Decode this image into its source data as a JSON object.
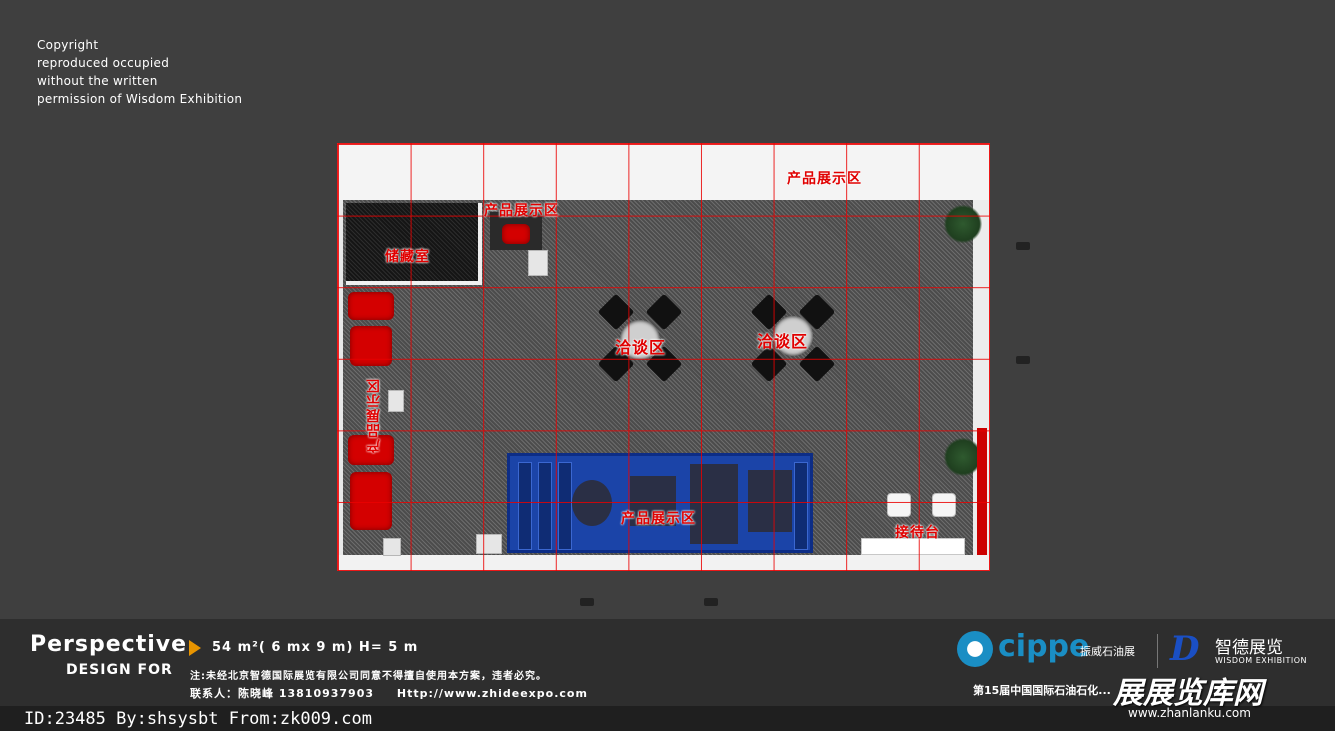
{
  "copyright": {
    "line1": "Copyright",
    "line2": "reproduced occupied",
    "line3": "without the written",
    "line4": "permission of Wisdom Exhibition"
  },
  "plan": {
    "zones": {
      "product_top_right": "产品展示区",
      "product_top_left": "产品展示区",
      "storage": "储藏室",
      "negotiation_1": "洽谈区",
      "negotiation_2": "洽谈区",
      "product_left": "产品展示区",
      "product_bottom": "产品展示区",
      "reception": "接待台"
    }
  },
  "footer": {
    "perspective": "Perspective",
    "design_for": "DESIGN FOR",
    "spec": "54 m²( 6 mx 9 m)    H= 5 m",
    "note": "注:未经北京智德国际展览有限公司同意不得擅自使用本方案，违者必究。",
    "contact_person": "联系人：陈晓峰 13810937903",
    "website": "Http://www.zhideexpo.com",
    "cippe": "cippe",
    "cippe_cn": "振威石油展",
    "wisdom_cn": "智德展览",
    "wisdom_en": "WISDOM EXHIBITION",
    "event": "第15届中国国际石油石化..."
  },
  "id_bar": "ID:23485 By:shsysbt From:zk009.com",
  "watermark": {
    "text": "展展览库网",
    "url": "www.zhanlanku.com"
  },
  "colors": {
    "background": "#3f3f3f",
    "zone_label": "#e00000",
    "grid": "#eb0000",
    "cippe_blue": "#1a8ec4",
    "arrow": "#e89400"
  }
}
